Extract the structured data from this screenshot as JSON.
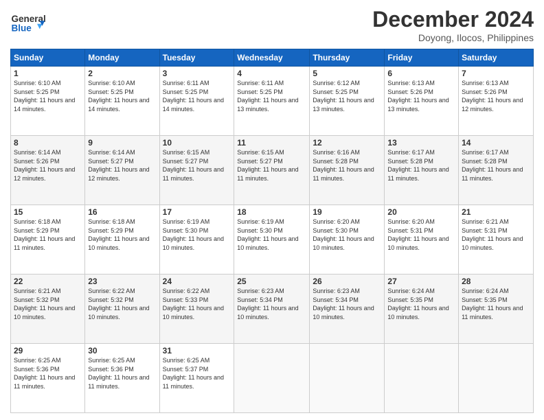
{
  "header": {
    "logo_general": "General",
    "logo_blue": "Blue",
    "month_title": "December 2024",
    "location": "Doyong, Ilocos, Philippines"
  },
  "days_of_week": [
    "Sunday",
    "Monday",
    "Tuesday",
    "Wednesday",
    "Thursday",
    "Friday",
    "Saturday"
  ],
  "weeks": [
    [
      {
        "day": "1",
        "sunrise": "Sunrise: 6:10 AM",
        "sunset": "Sunset: 5:25 PM",
        "daylight": "Daylight: 11 hours and 14 minutes."
      },
      {
        "day": "2",
        "sunrise": "Sunrise: 6:10 AM",
        "sunset": "Sunset: 5:25 PM",
        "daylight": "Daylight: 11 hours and 14 minutes."
      },
      {
        "day": "3",
        "sunrise": "Sunrise: 6:11 AM",
        "sunset": "Sunset: 5:25 PM",
        "daylight": "Daylight: 11 hours and 14 minutes."
      },
      {
        "day": "4",
        "sunrise": "Sunrise: 6:11 AM",
        "sunset": "Sunset: 5:25 PM",
        "daylight": "Daylight: 11 hours and 13 minutes."
      },
      {
        "day": "5",
        "sunrise": "Sunrise: 6:12 AM",
        "sunset": "Sunset: 5:25 PM",
        "daylight": "Daylight: 11 hours and 13 minutes."
      },
      {
        "day": "6",
        "sunrise": "Sunrise: 6:13 AM",
        "sunset": "Sunset: 5:26 PM",
        "daylight": "Daylight: 11 hours and 13 minutes."
      },
      {
        "day": "7",
        "sunrise": "Sunrise: 6:13 AM",
        "sunset": "Sunset: 5:26 PM",
        "daylight": "Daylight: 11 hours and 12 minutes."
      }
    ],
    [
      {
        "day": "8",
        "sunrise": "Sunrise: 6:14 AM",
        "sunset": "Sunset: 5:26 PM",
        "daylight": "Daylight: 11 hours and 12 minutes."
      },
      {
        "day": "9",
        "sunrise": "Sunrise: 6:14 AM",
        "sunset": "Sunset: 5:27 PM",
        "daylight": "Daylight: 11 hours and 12 minutes."
      },
      {
        "day": "10",
        "sunrise": "Sunrise: 6:15 AM",
        "sunset": "Sunset: 5:27 PM",
        "daylight": "Daylight: 11 hours and 11 minutes."
      },
      {
        "day": "11",
        "sunrise": "Sunrise: 6:15 AM",
        "sunset": "Sunset: 5:27 PM",
        "daylight": "Daylight: 11 hours and 11 minutes."
      },
      {
        "day": "12",
        "sunrise": "Sunrise: 6:16 AM",
        "sunset": "Sunset: 5:28 PM",
        "daylight": "Daylight: 11 hours and 11 minutes."
      },
      {
        "day": "13",
        "sunrise": "Sunrise: 6:17 AM",
        "sunset": "Sunset: 5:28 PM",
        "daylight": "Daylight: 11 hours and 11 minutes."
      },
      {
        "day": "14",
        "sunrise": "Sunrise: 6:17 AM",
        "sunset": "Sunset: 5:28 PM",
        "daylight": "Daylight: 11 hours and 11 minutes."
      }
    ],
    [
      {
        "day": "15",
        "sunrise": "Sunrise: 6:18 AM",
        "sunset": "Sunset: 5:29 PM",
        "daylight": "Daylight: 11 hours and 11 minutes."
      },
      {
        "day": "16",
        "sunrise": "Sunrise: 6:18 AM",
        "sunset": "Sunset: 5:29 PM",
        "daylight": "Daylight: 11 hours and 10 minutes."
      },
      {
        "day": "17",
        "sunrise": "Sunrise: 6:19 AM",
        "sunset": "Sunset: 5:30 PM",
        "daylight": "Daylight: 11 hours and 10 minutes."
      },
      {
        "day": "18",
        "sunrise": "Sunrise: 6:19 AM",
        "sunset": "Sunset: 5:30 PM",
        "daylight": "Daylight: 11 hours and 10 minutes."
      },
      {
        "day": "19",
        "sunrise": "Sunrise: 6:20 AM",
        "sunset": "Sunset: 5:30 PM",
        "daylight": "Daylight: 11 hours and 10 minutes."
      },
      {
        "day": "20",
        "sunrise": "Sunrise: 6:20 AM",
        "sunset": "Sunset: 5:31 PM",
        "daylight": "Daylight: 11 hours and 10 minutes."
      },
      {
        "day": "21",
        "sunrise": "Sunrise: 6:21 AM",
        "sunset": "Sunset: 5:31 PM",
        "daylight": "Daylight: 11 hours and 10 minutes."
      }
    ],
    [
      {
        "day": "22",
        "sunrise": "Sunrise: 6:21 AM",
        "sunset": "Sunset: 5:32 PM",
        "daylight": "Daylight: 11 hours and 10 minutes."
      },
      {
        "day": "23",
        "sunrise": "Sunrise: 6:22 AM",
        "sunset": "Sunset: 5:32 PM",
        "daylight": "Daylight: 11 hours and 10 minutes."
      },
      {
        "day": "24",
        "sunrise": "Sunrise: 6:22 AM",
        "sunset": "Sunset: 5:33 PM",
        "daylight": "Daylight: 11 hours and 10 minutes."
      },
      {
        "day": "25",
        "sunrise": "Sunrise: 6:23 AM",
        "sunset": "Sunset: 5:34 PM",
        "daylight": "Daylight: 11 hours and 10 minutes."
      },
      {
        "day": "26",
        "sunrise": "Sunrise: 6:23 AM",
        "sunset": "Sunset: 5:34 PM",
        "daylight": "Daylight: 11 hours and 10 minutes."
      },
      {
        "day": "27",
        "sunrise": "Sunrise: 6:24 AM",
        "sunset": "Sunset: 5:35 PM",
        "daylight": "Daylight: 11 hours and 10 minutes."
      },
      {
        "day": "28",
        "sunrise": "Sunrise: 6:24 AM",
        "sunset": "Sunset: 5:35 PM",
        "daylight": "Daylight: 11 hours and 11 minutes."
      }
    ],
    [
      {
        "day": "29",
        "sunrise": "Sunrise: 6:25 AM",
        "sunset": "Sunset: 5:36 PM",
        "daylight": "Daylight: 11 hours and 11 minutes."
      },
      {
        "day": "30",
        "sunrise": "Sunrise: 6:25 AM",
        "sunset": "Sunset: 5:36 PM",
        "daylight": "Daylight: 11 hours and 11 minutes."
      },
      {
        "day": "31",
        "sunrise": "Sunrise: 6:25 AM",
        "sunset": "Sunset: 5:37 PM",
        "daylight": "Daylight: 11 hours and 11 minutes."
      },
      null,
      null,
      null,
      null
    ]
  ]
}
